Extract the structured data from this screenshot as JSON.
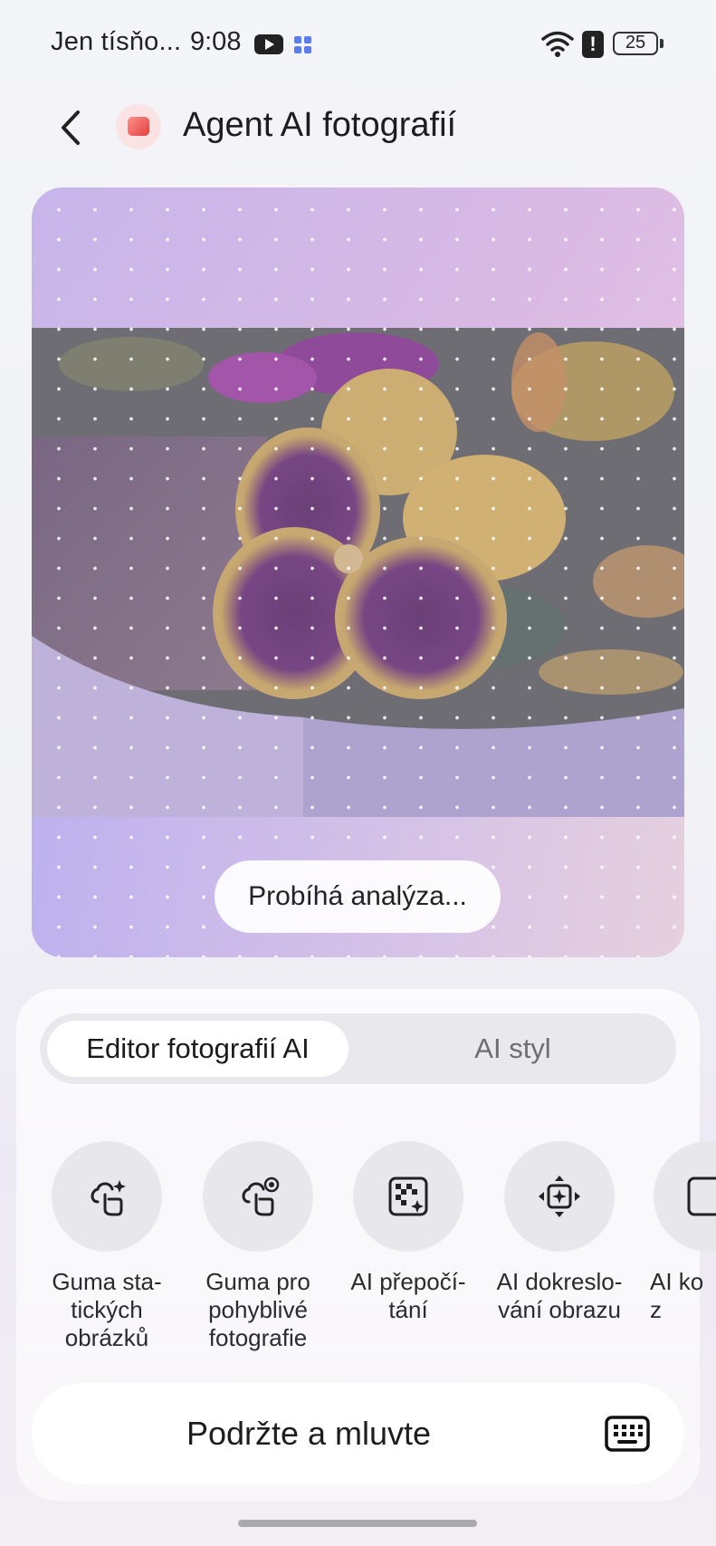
{
  "status_bar": {
    "carrier": "Jen tísňo...",
    "time": "9:08",
    "battery": "25"
  },
  "header": {
    "title": "Agent AI fotografií"
  },
  "photo_card": {
    "status_pill": "Probíhá analýza..."
  },
  "tabs": [
    {
      "label": "Editor fotografií AI",
      "active": true
    },
    {
      "label": "AI styl",
      "active": false
    }
  ],
  "tools": [
    {
      "label": "Guma sta-\ntických\nobrázků",
      "icon": "sparkle-eraser-icon"
    },
    {
      "label": "Guma pro\npohyblivé\nfotografie",
      "icon": "motion-eraser-icon"
    },
    {
      "label": "AI přepočí-\ntání",
      "icon": "ai-enhance-icon"
    },
    {
      "label": "AI dokreslo-\nvání obrazu",
      "icon": "ai-expand-icon"
    },
    {
      "label": "AI ko\nz",
      "icon": "ai-crop-icon"
    }
  ],
  "voice": {
    "label": "Podržte a mluvte"
  },
  "colors": {
    "accent_purple": "#c7b6ea",
    "sheet_bg": "#ffffff"
  }
}
